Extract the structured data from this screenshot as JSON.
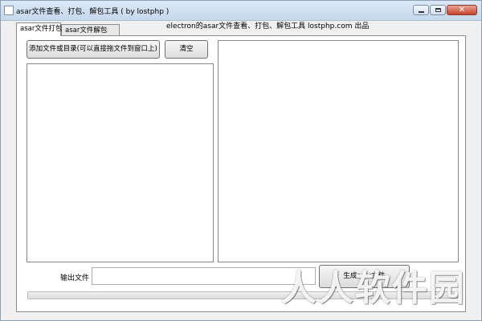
{
  "window": {
    "title": "asar文件查看、打包、解包工具 ( by lostphp )"
  },
  "header": {
    "caption": "electron的asar文件查看、打包、解包工具 lostphp.com 出品"
  },
  "tabs": [
    {
      "label": "asar文件打包",
      "active": true
    },
    {
      "label": "asar文件解包",
      "active": false
    }
  ],
  "pack": {
    "add_button_label": "添加文件或目录(可以直接拖文件到窗口上)",
    "clear_button_label": "清空",
    "output_label": "输出文件",
    "output_value": "",
    "generate_button_label": "生成asar文件",
    "progress": 0
  },
  "watermark": {
    "text": "人人软件园"
  },
  "colors": {
    "titlebar_top": "#dbe8f5",
    "titlebar_bottom": "#c6d8ec",
    "close_button": "#c7432d",
    "window_bg": "#f0f0f0"
  }
}
